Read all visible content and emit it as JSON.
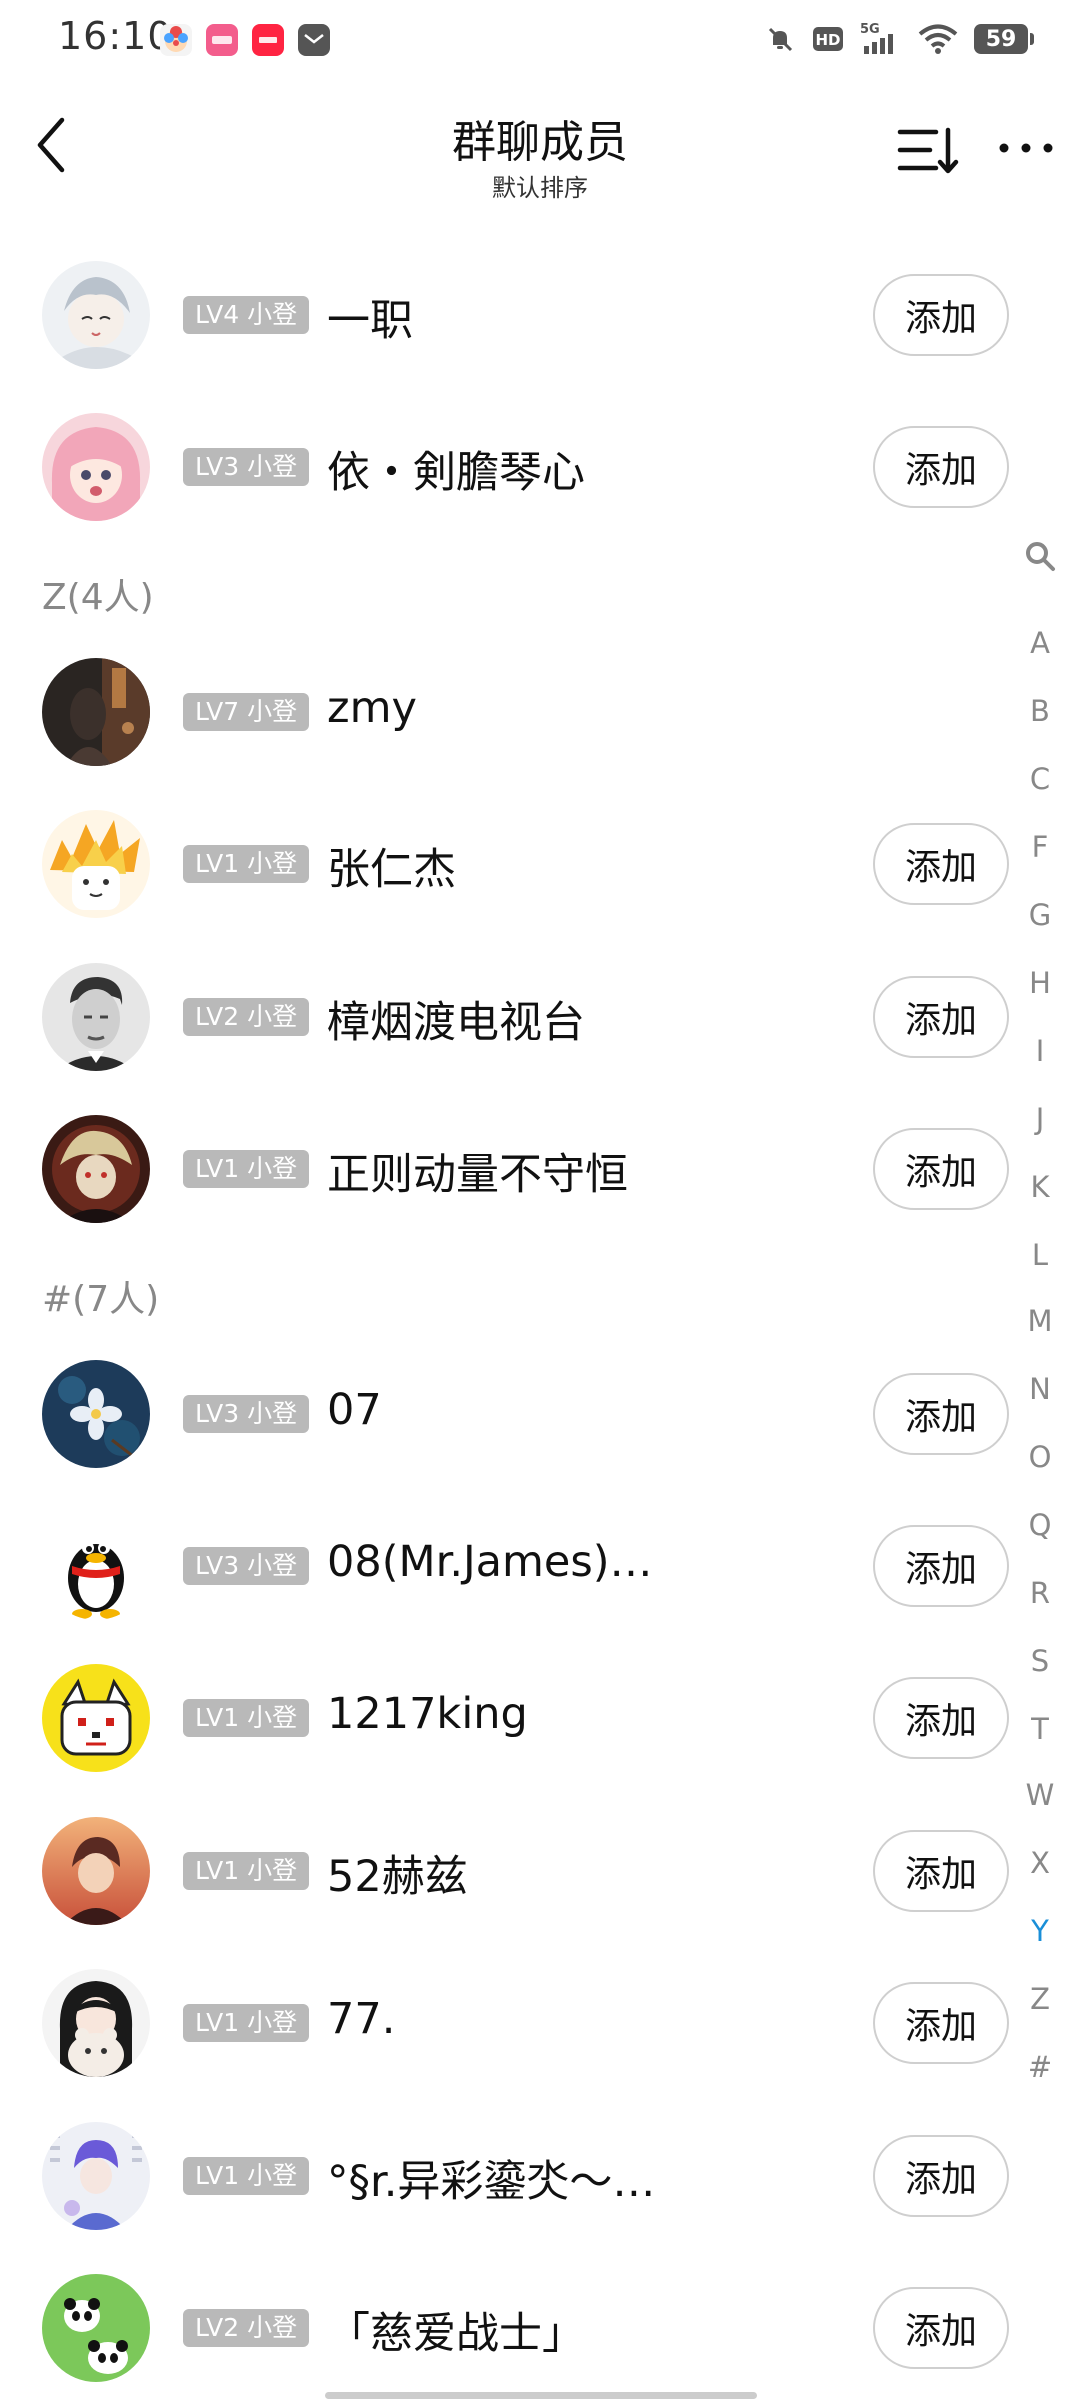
{
  "status_bar": {
    "time": "16:10",
    "network": "5G",
    "hd": "HD",
    "battery": "59",
    "icons": [
      "clown-app-icon",
      "lofter-app-icon",
      "xiaohongshu-app-icon",
      "mail-icon",
      "mute-icon",
      "hd-icon",
      "signal-icon",
      "wifi-icon",
      "battery-icon"
    ]
  },
  "header": {
    "title": "群聊成员",
    "subtitle": "默认排序"
  },
  "sections": [
    {
      "label": "Z(4人)"
    },
    {
      "label": "#(7人)"
    }
  ],
  "members": [
    {
      "level": "LV4 小登",
      "name": "一职",
      "add": "添加",
      "has_add": true
    },
    {
      "level": "LV3 小登",
      "name": "依・剣膽琴心",
      "add": "添加",
      "has_add": true
    },
    {
      "level": "LV7 小登",
      "name": "zmy",
      "add": "",
      "has_add": false
    },
    {
      "level": "LV1 小登",
      "name": "张仁杰",
      "add": "添加",
      "has_add": true
    },
    {
      "level": "LV2 小登",
      "name": "樟烟渡电视台",
      "add": "添加",
      "has_add": true
    },
    {
      "level": "LV1 小登",
      "name": "正则动量不守恒",
      "add": "添加",
      "has_add": true
    },
    {
      "level": "LV3 小登",
      "name": "07",
      "add": "添加",
      "has_add": true
    },
    {
      "level": "LV3 小登",
      "name": "08(Mr.James)…",
      "add": "添加",
      "has_add": true
    },
    {
      "level": "LV1 小登",
      "name": "1217king",
      "add": "添加",
      "has_add": true
    },
    {
      "level": "LV1 小登",
      "name": "52赫兹",
      "add": "添加",
      "has_add": true
    },
    {
      "level": "LV1 小登",
      "name": "77.",
      "add": "添加",
      "has_add": true
    },
    {
      "level": "LV1 小登",
      "name": "°§r.异彩鎏氼～…",
      "add": "添加",
      "has_add": true
    },
    {
      "level": "LV2 小登",
      "name": "「慈爱战士」",
      "add": "添加",
      "has_add": true
    }
  ],
  "index_letters": [
    "A",
    "B",
    "C",
    "F",
    "G",
    "H",
    "I",
    "J",
    "K",
    "L",
    "M",
    "N",
    "O",
    "Q",
    "R",
    "S",
    "T",
    "W",
    "X",
    "Y",
    "Z",
    "#"
  ],
  "active_index": "Y",
  "colors": {
    "badge_bg": "#b9b9b9",
    "active_index": "#1a8fd8",
    "section_text": "#888888"
  }
}
